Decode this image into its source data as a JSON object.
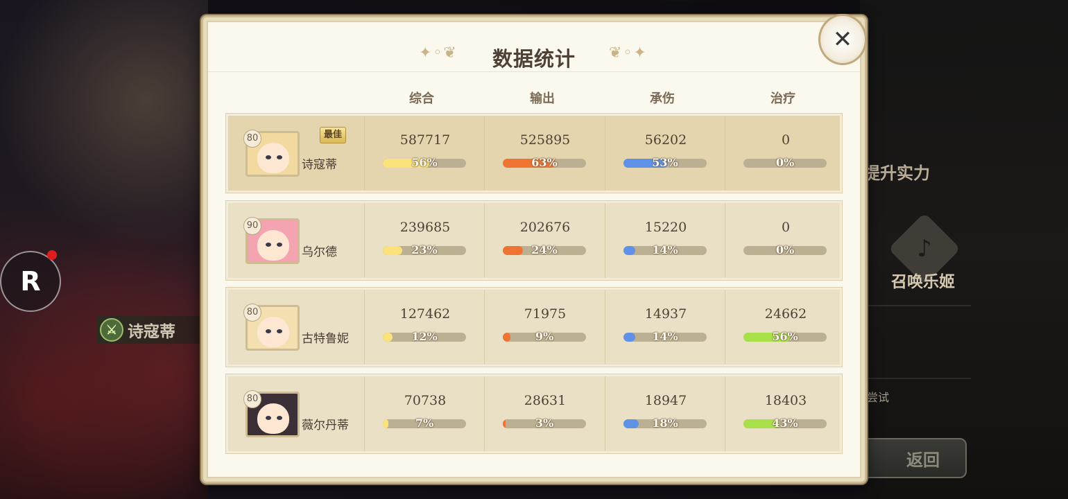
{
  "dialog": {
    "title": "数据统计",
    "close_icon": "close-icon",
    "columns": [
      "综合",
      "输出",
      "承伤",
      "治疗"
    ],
    "best_badge": "最佳",
    "bar_colors": [
      "#fbe27a",
      "#ef7434",
      "#5f92e6",
      "#a8e04a"
    ],
    "rows": [
      {
        "name": "诗寇蒂",
        "level": "80",
        "best": true,
        "stats": [
          {
            "value": "587717",
            "pct": "56%",
            "fraction": 0.56
          },
          {
            "value": "525895",
            "pct": "63%",
            "fraction": 0.63
          },
          {
            "value": "56202",
            "pct": "53%",
            "fraction": 0.53
          },
          {
            "value": "0",
            "pct": "0%",
            "fraction": 0
          }
        ]
      },
      {
        "name": "乌尔德",
        "level": "90",
        "best": false,
        "stats": [
          {
            "value": "239685",
            "pct": "23%",
            "fraction": 0.23
          },
          {
            "value": "202676",
            "pct": "24%",
            "fraction": 0.24
          },
          {
            "value": "15220",
            "pct": "14%",
            "fraction": 0.14
          },
          {
            "value": "0",
            "pct": "0%",
            "fraction": 0
          }
        ]
      },
      {
        "name": "古特鲁妮",
        "level": "80",
        "best": false,
        "stats": [
          {
            "value": "127462",
            "pct": "12%",
            "fraction": 0.12
          },
          {
            "value": "71975",
            "pct": "9%",
            "fraction": 0.09
          },
          {
            "value": "14937",
            "pct": "14%",
            "fraction": 0.14
          },
          {
            "value": "24662",
            "pct": "56%",
            "fraction": 0.56
          }
        ]
      },
      {
        "name": "薇尔丹蒂",
        "level": "80",
        "best": false,
        "stats": [
          {
            "value": "70738",
            "pct": "7%",
            "fraction": 0.07
          },
          {
            "value": "28631",
            "pct": "3%",
            "fraction": 0.03
          },
          {
            "value": "18947",
            "pct": "18%",
            "fraction": 0.18
          },
          {
            "value": "18403",
            "pct": "43%",
            "fraction": 0.43
          }
        ]
      }
    ]
  },
  "background": {
    "character_tag": "诗寇蒂",
    "right_title": "提升实力",
    "summon_label": "召唤乐姬",
    "try_label": "尝试",
    "return_label": "返回"
  }
}
